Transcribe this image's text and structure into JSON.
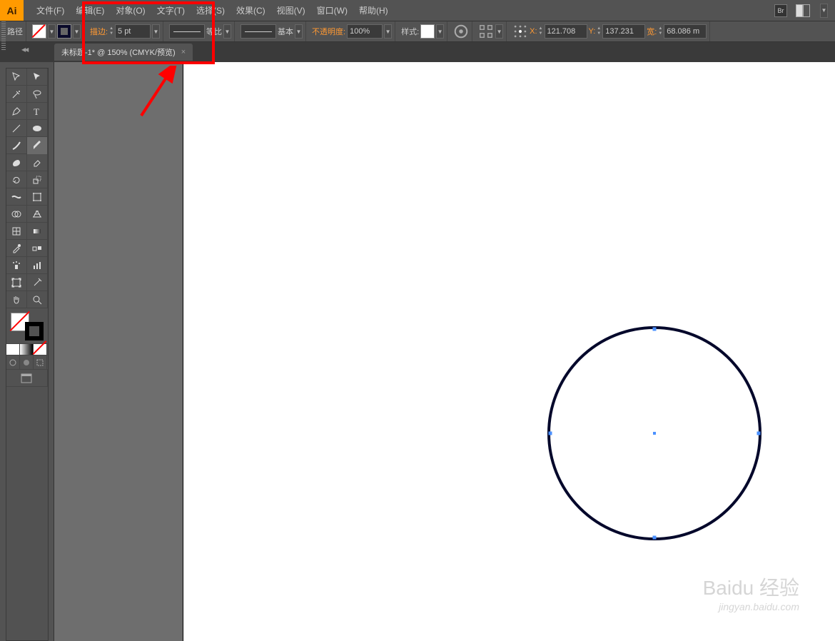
{
  "app_logo": "Ai",
  "menus": [
    "文件(F)",
    "编辑(E)",
    "对象(O)",
    "文字(T)",
    "选择(S)",
    "效果(C)",
    "视图(V)",
    "窗口(W)",
    "帮助(H)"
  ],
  "bridge_label": "Br",
  "control": {
    "selection_label": "路径",
    "stroke_label": "描边:",
    "stroke_value": "5 pt",
    "profile_label": "等比",
    "brush_label": "基本",
    "opacity_label": "不透明度:",
    "opacity_value": "100%",
    "style_label": "样式:",
    "x_label": "X:",
    "x_value": "121.708",
    "y_label": "Y:",
    "y_value": "137.231",
    "w_label": "宽:",
    "w_value": "68.086 m"
  },
  "tab": {
    "title": "未标题-1* @ 150% (CMYK/预览)",
    "close": "×"
  },
  "watermark": {
    "brand": "Baidu 经验",
    "url": "jingyan.baidu.com"
  }
}
